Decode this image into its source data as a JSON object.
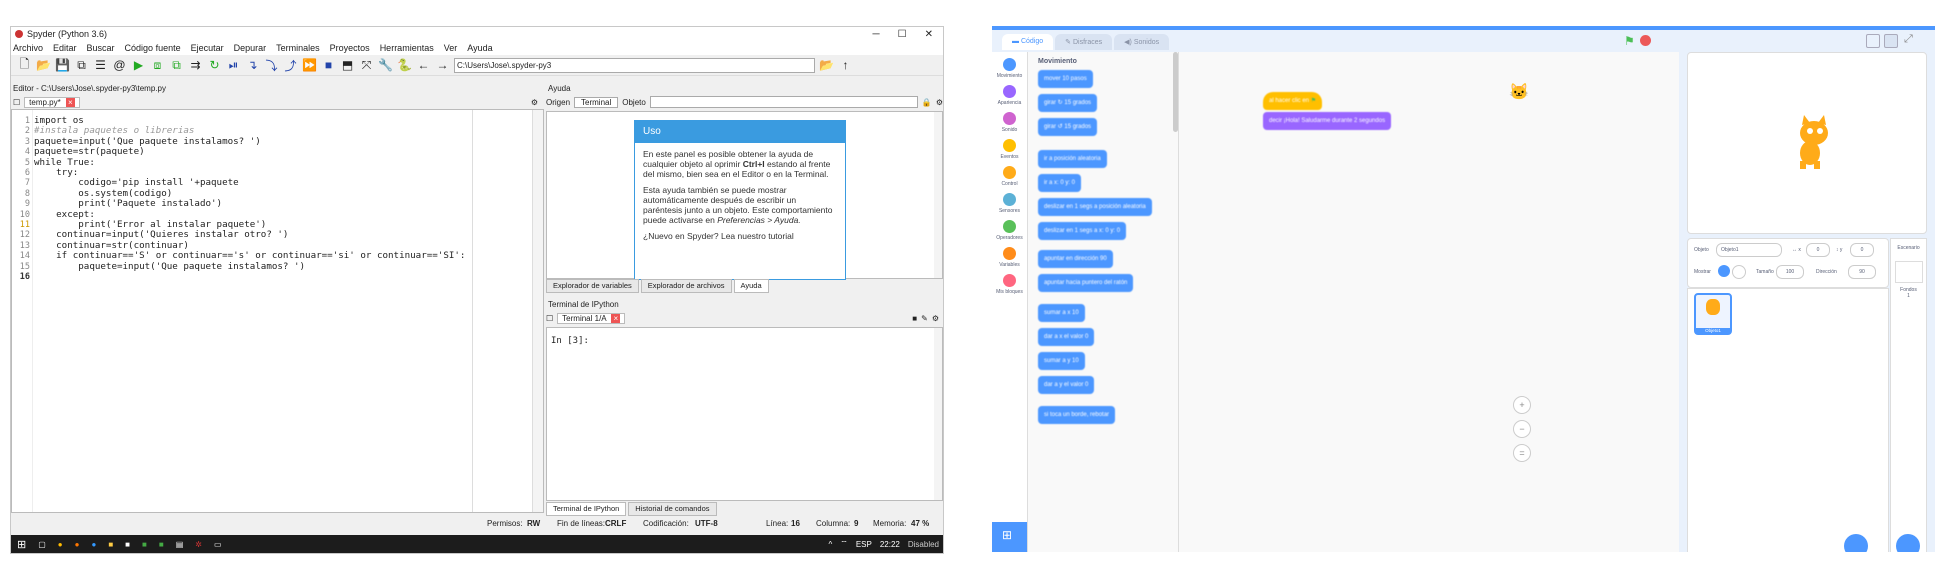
{
  "spyder": {
    "title": "Spyder (Python 3.6)",
    "menu": [
      "Archivo",
      "Editar",
      "Buscar",
      "Código fuente",
      "Ejecutar",
      "Depurar",
      "Terminales",
      "Proyectos",
      "Herramientas",
      "Ver",
      "Ayuda"
    ],
    "path": "C:\\Users\\Jose\\.spyder-py3",
    "editor_header": "Editor - C:\\Users\\Jose\\.spyder-py3\\temp.py",
    "editor_tab": "temp.py*",
    "code_lines": [
      "import os",
      "#instala paquetes o librerias",
      "paquete=input('Que paquete instalamos? ')",
      "paquete=str(paquete)",
      "while True:",
      "    try:",
      "        codigo='pip install '+paquete",
      "        os.system(codigo)",
      "        print('Paquete instalado')",
      "    except:",
      "        print('Error al instalar paquete')",
      "    continuar=input('Quieres instalar otro? ')",
      "    continuar=str(continuar)",
      "    if continuar=='S' or continuar=='s' or continuar=='si' or continuar=='SI':",
      "        paquete=input('Que paquete instalamos? ')",
      ""
    ],
    "help": {
      "header": "Ayuda",
      "origin_label": "Origen",
      "origin_value": "Terminal",
      "object_label": "Objeto",
      "card_title": "Uso",
      "p1_a": "En este panel es posible obtener la ayuda de cualquier objeto al oprimir ",
      "p1_key": "Ctrl+I",
      "p1_b": " estando al frente del mismo, bien sea en el Editor o en la Terminal.",
      "p2": "Esta ayuda también se puede mostrar automáticamente después de escribir un paréntesis junto a un objeto. Este comportamiento puede activarse en ",
      "p2_em": "Preferencias > Ayuda.",
      "p3": "¿Nuevo en Spyder? Lea nuestro tutorial",
      "tabs": [
        "Explorador de variables",
        "Explorador de archivos",
        "Ayuda"
      ]
    },
    "terminal": {
      "header": "Terminal de IPython",
      "tab": "Terminal 1/A",
      "prompt": "In [3]:",
      "bottom_tabs": [
        "Terminal de IPython",
        "Historial de comandos"
      ]
    },
    "status": {
      "permisos": "Permisos:",
      "permisos_val": "RW",
      "fin_label": "Fin de líneas:",
      "fin_val": "CRLF",
      "cod_label": "Codificación:",
      "cod_val": "UTF-8",
      "linea_label": "Línea:",
      "linea_val": "16",
      "col_label": "Columna:",
      "col_val": "9",
      "mem_label": "Memoria:",
      "mem_val": "47 %"
    },
    "taskbar": {
      "lang": "ESP",
      "time": "22:22",
      "extra": "Disabled"
    }
  },
  "scratch": {
    "tabs": [
      "Código",
      "Disfraces",
      "Sonidos"
    ],
    "categories": [
      {
        "label": "Movimiento",
        "color": "#4c97ff"
      },
      {
        "label": "Apariencia",
        "color": "#9966ff"
      },
      {
        "label": "Sonido",
        "color": "#cf63cf"
      },
      {
        "label": "Eventos",
        "color": "#ffbf00"
      },
      {
        "label": "Control",
        "color": "#ffab19"
      },
      {
        "label": "Sensores",
        "color": "#5cb1d6"
      },
      {
        "label": "Operadores",
        "color": "#59c059"
      },
      {
        "label": "Variables",
        "color": "#ff8c1a"
      },
      {
        "label": "Mis bloques",
        "color": "#ff6680"
      }
    ],
    "section_title": "Movimiento",
    "palette_blocks": [
      "mover 10 pasos",
      "girar ↻ 15 grados",
      "girar ↺ 15 grados",
      "ir a posición aleatoria",
      "ir a x: 0 y: 0",
      "deslizar en 1 segs a posición aleatoria",
      "deslizar en 1 segs a x: 0 y: 0",
      "apuntar en dirección 90",
      "apuntar hacia puntero del ratón",
      "sumar a x 10",
      "dar a x el valor 0",
      "sumar a y 10",
      "dar a y el valor 0",
      "si toca un borde, rebotar"
    ],
    "script_hat": "al hacer clic en",
    "script_say": "decir ¡Hola! Saludarme durante 2 segundos",
    "sprite_info": {
      "objeto_label": "Objeto",
      "objeto_val": "Objeto1",
      "x_val": "0",
      "y_val": "0",
      "mostrar_label": "Mostrar",
      "tamano_label": "Tamaño",
      "tamano_val": "100",
      "direccion_label": "Dirección",
      "direccion_val": "90"
    },
    "sprite_name": "Objeto1",
    "stage_label": "Escenario",
    "fondos_label": "Fondos",
    "fondos_count": "1"
  }
}
